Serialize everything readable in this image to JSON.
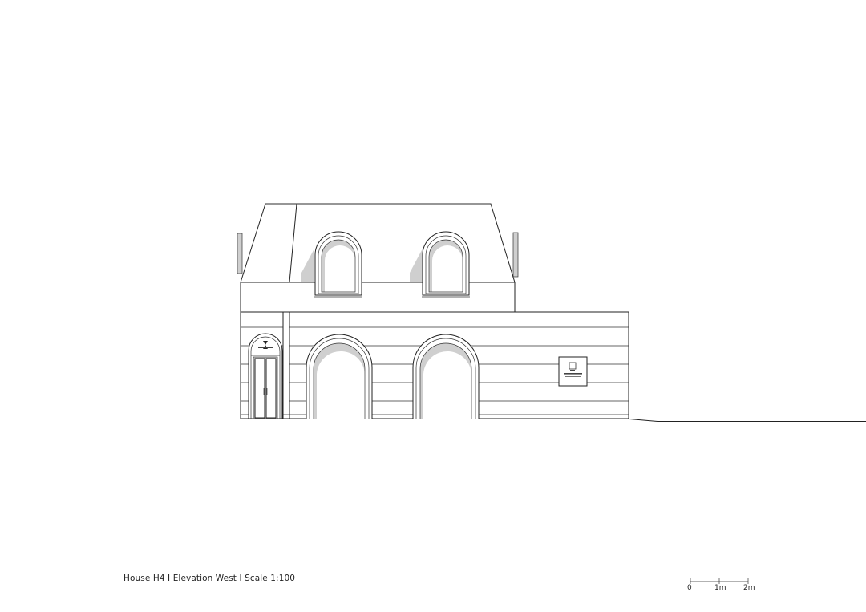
{
  "caption": "House H4 I Elevation West I Scale 1:100",
  "scale_bar": {
    "labels": [
      "0",
      "1m",
      "2m"
    ]
  },
  "colors": {
    "line": "#222222",
    "background": "#ffffff",
    "shadow": "#cfcfcf"
  }
}
